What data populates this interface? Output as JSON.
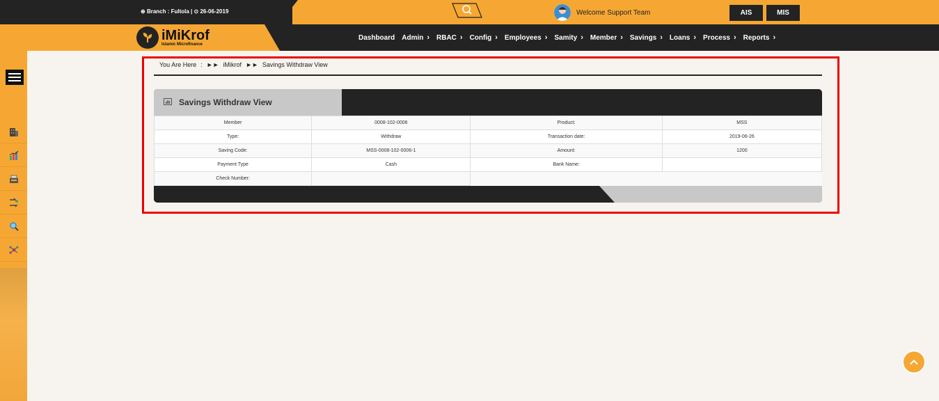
{
  "topbar": {
    "branch": "Branch : Fultola |",
    "date": "26-06-2019",
    "welcome": "Welcome Support Team",
    "ais_label": "AIS",
    "mis_label": "MIS"
  },
  "logo": {
    "title": "iMiKrof",
    "subtitle": "Islamic Microfinance"
  },
  "nav": {
    "items": [
      {
        "label": "Dashboard",
        "caret": ""
      },
      {
        "label": "Admin",
        "caret": "›"
      },
      {
        "label": "RBAC",
        "caret": "›"
      },
      {
        "label": "Config",
        "caret": "›"
      },
      {
        "label": "Employees",
        "caret": "›"
      },
      {
        "label": "Samity",
        "caret": "›"
      },
      {
        "label": "Member",
        "caret": "›"
      },
      {
        "label": "Savings",
        "caret": "›"
      },
      {
        "label": "Loans",
        "caret": "›"
      },
      {
        "label": "Process",
        "caret": "›"
      },
      {
        "label": "Reports",
        "caret": "›"
      }
    ]
  },
  "breadcrumb": {
    "prefix": "You Are Here",
    "colon": ":",
    "root": "iMikrof",
    "current": "Savings Withdraw View"
  },
  "panel": {
    "title": "Savings Withdraw View",
    "rows": [
      [
        "Member",
        "0008-102-0006",
        "Product:",
        "MSS"
      ],
      [
        "Type:",
        "Withdraw",
        "Transaction date:",
        "2019-06-26"
      ],
      [
        "Saving Code:",
        "MSS-0008-102-0006-1",
        "Amount:",
        "1200"
      ],
      [
        "Payment Type",
        "Cash",
        "Bank Name:",
        ""
      ],
      [
        "Check Number:",
        ""
      ]
    ]
  },
  "colors": {
    "accent": "#f6a733",
    "dark": "#232323",
    "highlight": "#ee0000"
  }
}
